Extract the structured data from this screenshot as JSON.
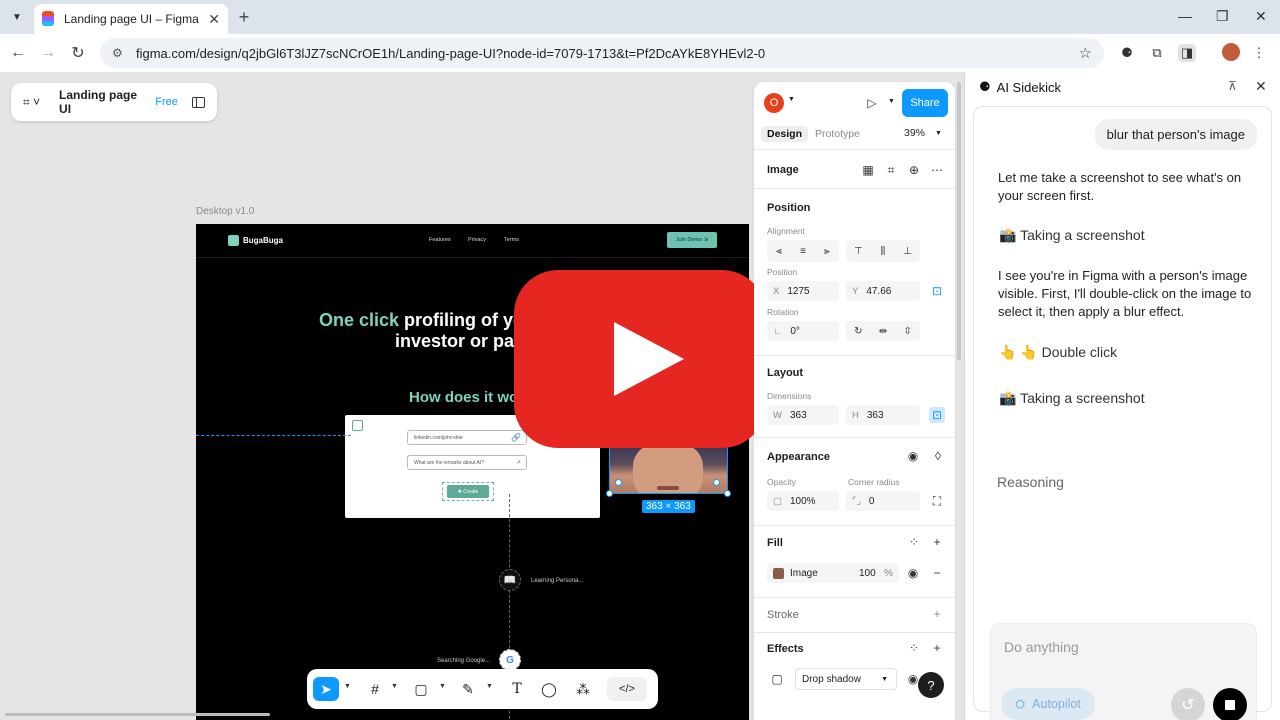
{
  "browser": {
    "tab_title": "Landing page UI – Figma",
    "tab_close": "✕",
    "new_tab": "+",
    "url": "figma.com/design/q2jbGl6T3lJZ7scNCrOE1h/Landing-page-UI?node-id=7079-1713&t=Pf2DcAYkE8YHEvl2-0"
  },
  "figma": {
    "file_name": "Landing page UI",
    "plan": "Free",
    "frame_label": "Desktop v1.0",
    "selection_size": "363 × 363"
  },
  "landing": {
    "brand": "BugaBuga",
    "nav": [
      "Features",
      "Privacy",
      "Terms"
    ],
    "cta": "Join Demo",
    "headline_accent": "One click",
    "headline_rest": " profiling of you",
    "headline_line2": "investor or par",
    "subheading": "How does it wo",
    "input1": "linkedin.com/john-doe",
    "input2": "What are his remarks about AI?",
    "create": "Create",
    "step1": "Learning Persona...",
    "step2": "Searching Google..."
  },
  "props": {
    "avatar_initial": "O",
    "share": "Share",
    "tabs": {
      "design": "Design",
      "prototype": "Prototype"
    },
    "zoom": "39%",
    "layer_type": "Image",
    "position_title": "Position",
    "alignment_label": "Alignment",
    "position_label": "Position",
    "x_label": "X",
    "x_value": "1275",
    "y_label": "Y",
    "y_value": "47.66",
    "rotation_label": "Rotation",
    "rotation_value": "0°",
    "layout_title": "Layout",
    "dimensions_label": "Dimensions",
    "w_label": "W",
    "w_value": "363",
    "h_label": "H",
    "h_value": "363",
    "appearance_title": "Appearance",
    "opacity_label": "Opacity",
    "opacity_value": "100%",
    "radius_label": "Corner radius",
    "radius_value": "0",
    "fill_title": "Fill",
    "fill_type": "Image",
    "fill_opacity": "100",
    "fill_unit": "%",
    "stroke_title": "Stroke",
    "effects_title": "Effects",
    "effect_type": "Drop shadow",
    "help": "?"
  },
  "sidekick": {
    "title": "AI Sidekick",
    "user_message": "blur that person's image",
    "reply1": "Let me take a screenshot to see what's on your screen first.",
    "step_screenshot_1": "📸 Taking a screenshot",
    "reply2": "I see you're in Figma with a person's image visible. First, I'll double-click on the image to select it, then apply a blur effect.",
    "step_double_click": "👆 👆 Double click",
    "step_screenshot_2": "📸 Taking a screenshot",
    "reasoning": "Reasoning",
    "composer_placeholder": "Do anything",
    "autopilot": "Autopilot"
  },
  "colors": {
    "figma_blue": "#0d99ff",
    "youtube_red": "#e52621",
    "landing_accent": "#7fd1c0"
  }
}
